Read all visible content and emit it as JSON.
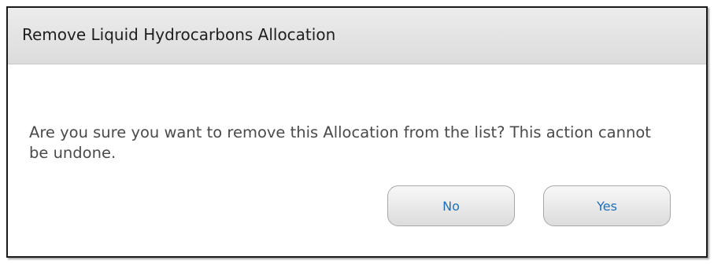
{
  "dialog": {
    "title": "Remove Liquid Hydrocarbons Allocation",
    "message": "Are you sure you want to remove this Allocation from the list?  This action cannot be undone.",
    "buttons": {
      "no_label": "No",
      "yes_label": "Yes"
    }
  },
  "colors": {
    "title_bar": "#e4e4e4",
    "button_text": "#1f6fb8",
    "message_text": "#4a4a4a",
    "border": "#1a1a1a"
  }
}
